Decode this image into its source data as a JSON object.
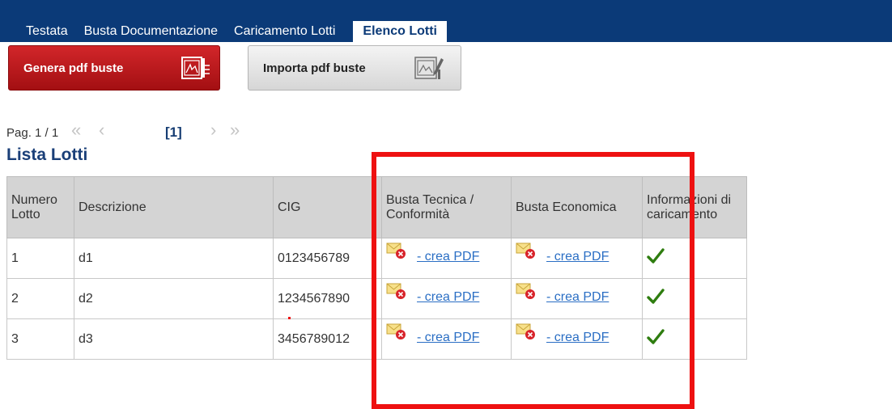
{
  "tabs": [
    {
      "label": "Testata"
    },
    {
      "label": "Busta Documentazione"
    },
    {
      "label": "Caricamento Lotti"
    },
    {
      "label": "Elenco Lotti"
    }
  ],
  "buttons": {
    "genera": {
      "label": "Genera pdf buste",
      "icon": "pdf-generate-icon"
    },
    "importa": {
      "label": "Importa pdf buste",
      "icon": "pdf-import-icon"
    }
  },
  "pager": {
    "info": "Pag. 1 / 1",
    "first": "«",
    "prev": "‹",
    "current": "[1]",
    "next": "›",
    "last": "»"
  },
  "list_title": "Lista Lotti",
  "table": {
    "headers": {
      "numero": "Numero Lotto",
      "descrizione": "Descrizione",
      "cig": "CIG",
      "tecnica": "Busta Tecnica / Conformità",
      "economica": "Busta Economica",
      "info": "Informazioni di caricamento"
    },
    "rows": [
      {
        "numero": "1",
        "descrizione": "d1",
        "cig": "0123456789",
        "tecnica": "- crea PDF",
        "economica": "- crea PDF"
      },
      {
        "numero": "2",
        "descrizione": "d2",
        "cig": "1234567890",
        "tecnica": "- crea PDF",
        "economica": "- crea PDF"
      },
      {
        "numero": "3",
        "descrizione": "d3",
        "cig": "3456789012",
        "tecnica": "- crea PDF",
        "economica": "- crea PDF"
      }
    ]
  },
  "icons": {
    "envelope": "envelope-error-icon",
    "check": "checkmark-icon"
  },
  "colors": {
    "navbar": "#0b3a78",
    "primary_button": "#c0181c",
    "highlight": "#ee1111",
    "link": "#2a6ec4",
    "check": "#2e7d0f"
  }
}
